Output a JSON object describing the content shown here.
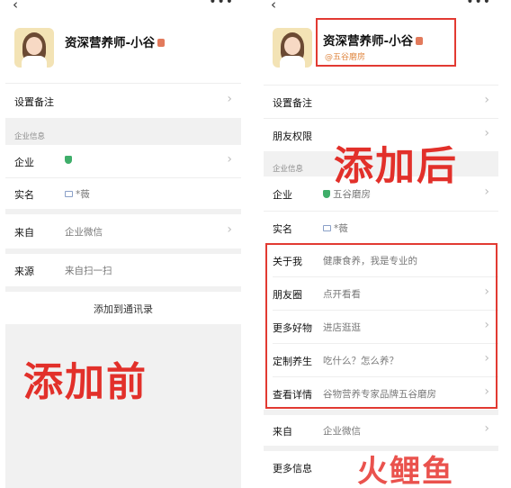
{
  "left": {
    "profile_name": "资深营养师-小谷",
    "rows": {
      "remark": "设置备注",
      "section": "企业信息",
      "enterprise": "企业",
      "realname": "实名",
      "realname_value": "*薇",
      "from": "来自",
      "from_value": "企业微信",
      "source": "来源",
      "source_value": "来自扫一扫"
    },
    "action": "添加到通讯录",
    "caption": "添加前"
  },
  "right": {
    "profile_name": "资深营养师-小谷",
    "profile_corp": "@五谷磨房",
    "rows": {
      "remark": "设置备注",
      "permission": "朋友权限",
      "section": "企业信息",
      "enterprise": "企业",
      "enterprise_value": "五谷磨房",
      "realname": "实名",
      "realname_value": "*薇",
      "about": "关于我",
      "about_value": "健康食养，我是专业的",
      "moments": "朋友圈",
      "moments_value": "点开看看",
      "more_goods": "更多好物",
      "more_goods_value": "进店逛逛",
      "custom": "定制养生",
      "custom_value": "吃什么？怎么养？",
      "details": "查看详情",
      "details_value": "谷物营养专家品牌五谷磨房",
      "from": "来自",
      "from_value": "企业微信",
      "more_info": "更多信息"
    },
    "caption": "添加后"
  },
  "watermark": "火鲤鱼",
  "colors": {
    "accent_red": "#e2302a",
    "verified_green": "#3fae6a",
    "corp_orange": "#e08a45"
  }
}
